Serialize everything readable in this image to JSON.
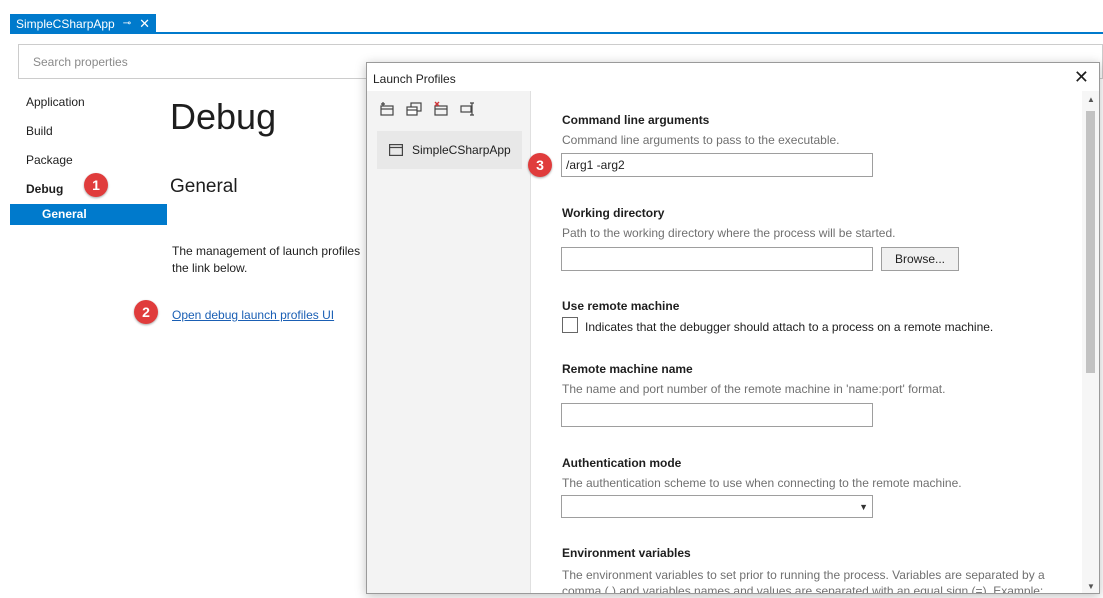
{
  "tab": {
    "title": "SimpleCSharpApp",
    "pin_icon": "pin-icon",
    "close_icon": "close-icon"
  },
  "search": {
    "placeholder": "Search properties"
  },
  "sidebar": {
    "items": [
      {
        "label": "Application"
      },
      {
        "label": "Build"
      },
      {
        "label": "Package"
      },
      {
        "label": "Debug"
      }
    ],
    "selected_sub": "General"
  },
  "main": {
    "title": "Debug",
    "section": "General",
    "description_line1": "The management of launch profiles",
    "description_line2": "the link below.",
    "link": "Open debug launch profiles UI"
  },
  "badges": {
    "one": "1",
    "two": "2",
    "three": "3"
  },
  "dialog": {
    "title": "Launch Profiles",
    "close_glyph": "✕",
    "toolbar_icons": [
      "new-profile-icon",
      "duplicate-profile-icon",
      "delete-profile-icon",
      "rename-profile-icon"
    ],
    "profile": {
      "name": "SimpleCSharpApp",
      "icon": "window-icon"
    },
    "fields": {
      "cmd": {
        "title": "Command line arguments",
        "desc": "Command line arguments to pass to the executable.",
        "value": "/arg1 -arg2"
      },
      "workdir": {
        "title": "Working directory",
        "desc": "Path to the working directory where the process will be started.",
        "value": "",
        "browse": "Browse..."
      },
      "remote": {
        "title": "Use remote machine",
        "label": "Indicates that the debugger should attach to a process on a remote machine.",
        "checked": false
      },
      "remote_name": {
        "title": "Remote machine name",
        "desc": "The name and port number of the remote machine in 'name:port' format.",
        "value": ""
      },
      "auth": {
        "title": "Authentication mode",
        "desc": "The authentication scheme to use when connecting to the remote machine.",
        "value": ""
      },
      "env": {
        "title": "Environment variables",
        "desc": "The environment variables to set prior to running the process. Variables are separated by a comma (,) and variables names and values are separated with an equal sign (=). Example:"
      }
    }
  },
  "colors": {
    "accent": "#007acc",
    "badge": "#e03c3c",
    "link": "#1a5fb4"
  }
}
